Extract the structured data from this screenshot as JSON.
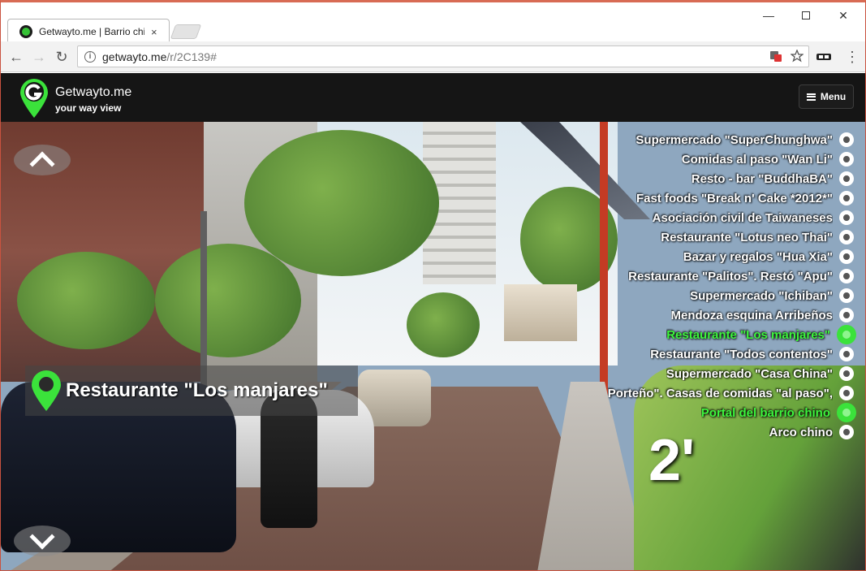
{
  "browser": {
    "tab_title": "Getwayto.me | Barrio chi",
    "tab_close": "×",
    "window_min": "—",
    "window_close": "✕",
    "back": "←",
    "forward": "→",
    "reload": "↻",
    "info": "i",
    "url_host": "getwayto.me",
    "url_path": "/r/2C139#",
    "menu": "⋮",
    "icons": [
      "translate-icon",
      "star-icon",
      "extension-icon"
    ]
  },
  "site": {
    "brand": "Getwayto.me",
    "tagline": "your way view",
    "menu_label": "Menu",
    "accent_color": "#3be23b"
  },
  "current_place": {
    "title": "Restaurante \"Los manjares\""
  },
  "poi_list": [
    {
      "label": "Supermercado \"SuperChunghwa\"",
      "active": false
    },
    {
      "label": "Comidas al paso \"Wan Li\"",
      "active": false
    },
    {
      "label": "Resto - bar \"BuddhaBA\"",
      "active": false
    },
    {
      "label": "Fast foods \"Break n' Cake *2012*\"",
      "active": false
    },
    {
      "label": "Asociación civil de Taiwaneses",
      "active": false
    },
    {
      "label": "Restaurante \"Lotus neo Thai\"",
      "active": false
    },
    {
      "label": "Bazar y regalos \"Hua Xia\"",
      "active": false
    },
    {
      "label": "Restaurante \"Palitos\". Restó \"Apu\"",
      "active": false
    },
    {
      "label": "Supermercado \"Ichiban\"",
      "active": false
    },
    {
      "label": "Mendoza esquina Arribeños",
      "active": false
    },
    {
      "label": "Restaurante \"Los manjares\"",
      "active": true
    },
    {
      "label": "Restaurante \"Todos contentos\"",
      "active": false
    },
    {
      "label": "Supermercado \"Casa China\"",
      "active": false
    },
    {
      "label": "Porteño\". Casas de comidas \"al paso\",",
      "active": false
    },
    {
      "label": "Portal del barrio chino",
      "active": true
    },
    {
      "label": "Arco chino",
      "active": false
    }
  ],
  "eta": "2'"
}
